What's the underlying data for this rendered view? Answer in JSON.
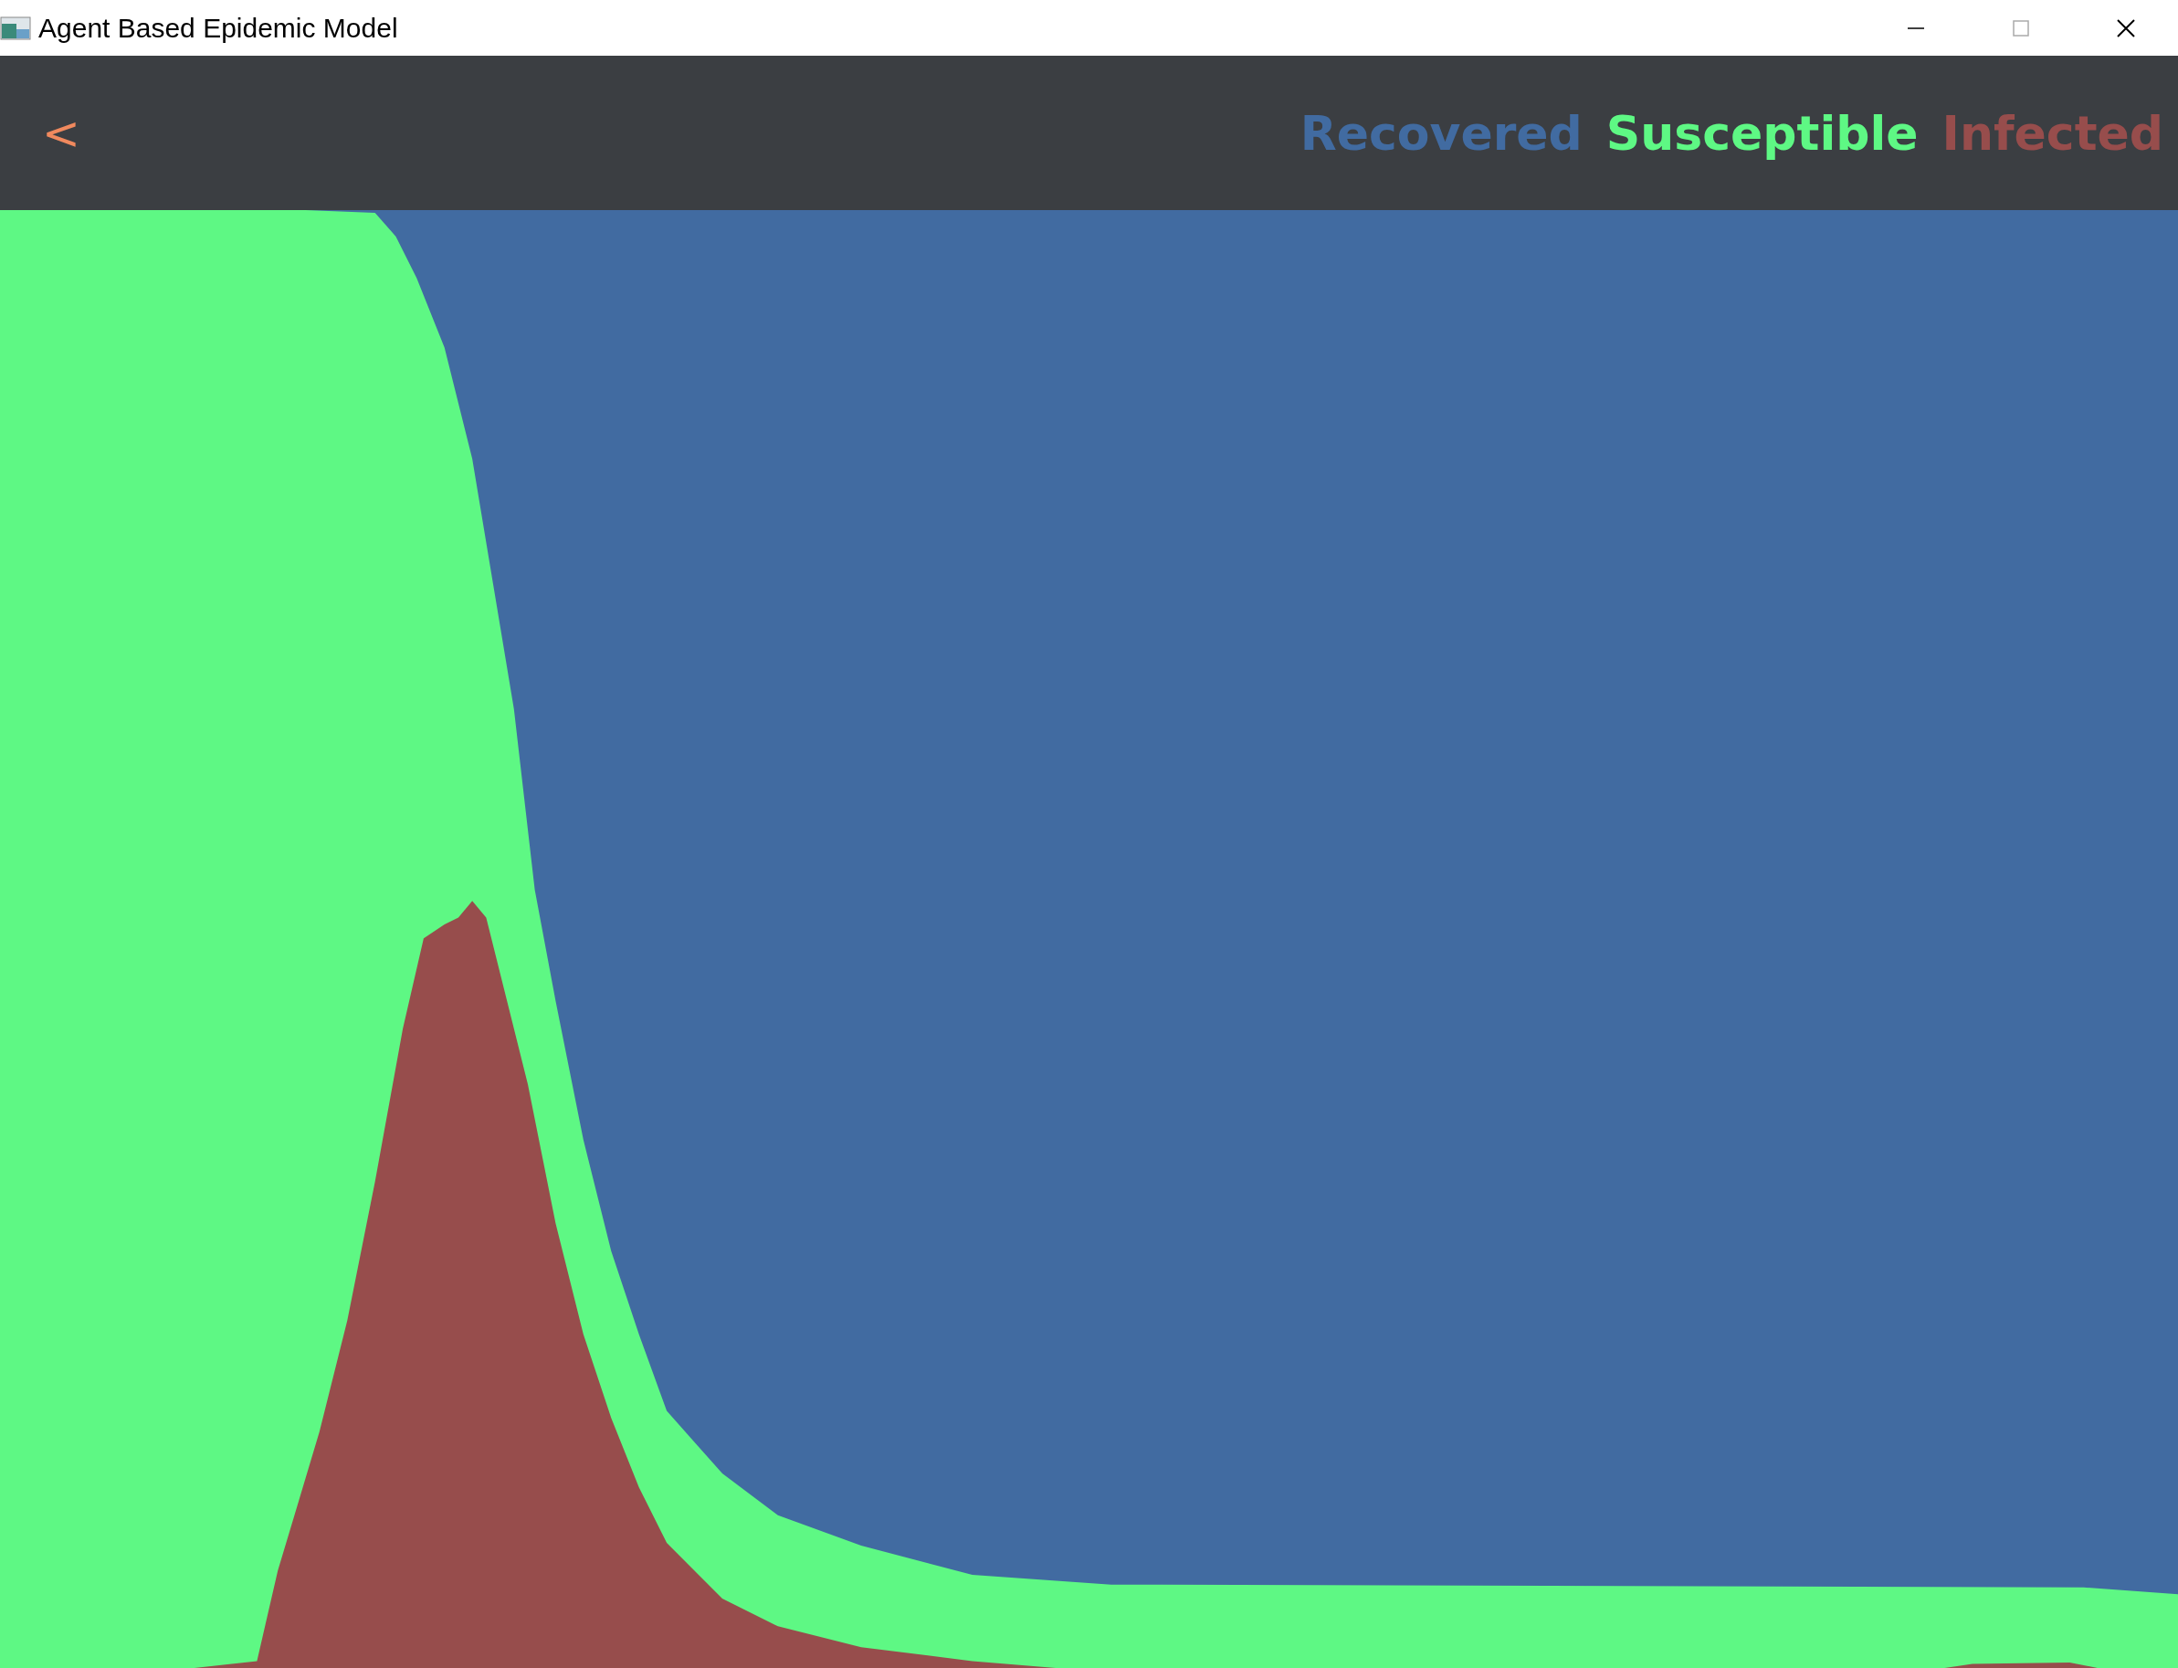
{
  "window": {
    "title": "Agent Based Epidemic Model"
  },
  "header": {
    "back": "<",
    "legend": [
      {
        "label": "Recovered",
        "color": "#416ba1"
      },
      {
        "label": "Susceptible",
        "color": "#5ef884"
      },
      {
        "label": "Infected",
        "color": "#974d4c"
      }
    ]
  }
}
